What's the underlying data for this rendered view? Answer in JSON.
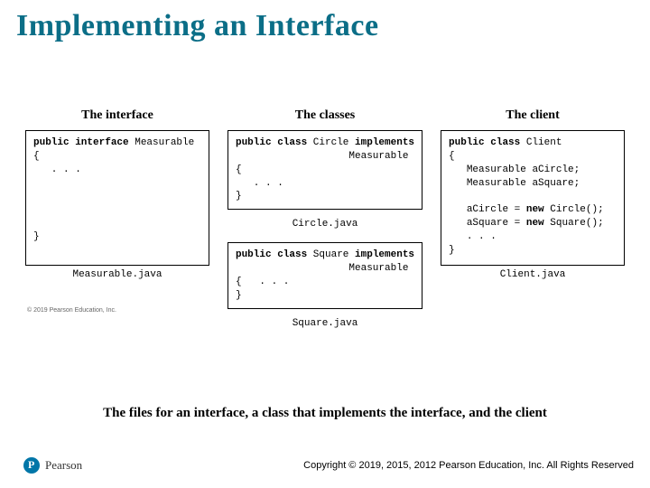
{
  "title": "Implementing an Interface",
  "columns": {
    "interface": {
      "heading": "The interface",
      "decl_kw": "public interface",
      "decl_name": " Measurable",
      "filename": "Measurable.java"
    },
    "classes": {
      "heading": "The classes",
      "circle": {
        "decl_kw": "public class",
        "decl_name": " Circle ",
        "impl_kw": "implements",
        "impl_name": "Measurable",
        "filename": "Circle.java"
      },
      "square": {
        "decl_kw": "public class",
        "decl_name": " Square ",
        "impl_kw": "implements",
        "impl_name": "Measurable",
        "filename": "Square.java"
      }
    },
    "client": {
      "heading": "The client",
      "decl_kw": "public class",
      "decl_name": " Client",
      "line1": "   Measurable aCircle;",
      "line2": "   Measurable aSquare;",
      "line3a": "   aCircle = ",
      "line3kw": "new",
      "line3b": " Circle();",
      "line4a": "   aSquare = ",
      "line4kw": "new",
      "line4b": " Square();",
      "filename": "Client.java"
    }
  },
  "ellipsis": "   . . .",
  "short_ellipsis": "  . . .",
  "brace_open": "{",
  "brace_close": "}",
  "credit": "© 2019 Pearson Education, Inc.",
  "caption": "The files for an interface, a class that implements the interface, and the client",
  "footer": {
    "brand": "Pearson",
    "copyright": "Copyright © 2019, 2015, 2012 Pearson Education, Inc. All Rights Reserved"
  },
  "chart_data": null
}
